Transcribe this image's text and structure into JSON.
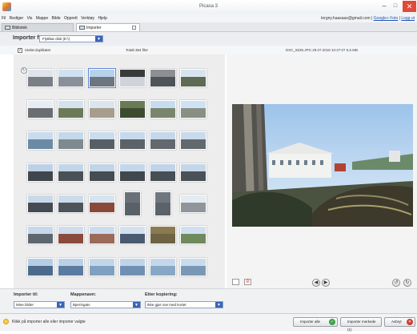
{
  "window": {
    "title": "Picasa 3",
    "min_glyph": "–",
    "max_glyph": "□",
    "close_glyph": "✕"
  },
  "menu": [
    "Fil",
    "Rediger",
    "Vis",
    "Mappe",
    "Bilde",
    "Opprett",
    "Verktøy",
    "Hjelp"
  ],
  "account": {
    "email": "torgny.haasaas@gmail.com",
    "sep": "|",
    "link1": "Google+ Foto",
    "link2": "Logg ut"
  },
  "tabs": [
    {
      "label": "Bibliotek"
    },
    {
      "label": "Importer"
    }
  ],
  "import_from": {
    "label": "Importer fra:",
    "source": "Flyttbar disk (E:\\)"
  },
  "info": {
    "duplicates_label": "Utelat duplikater",
    "duplicates_checked": "✓",
    "total": "Totalt 364 filer",
    "file_info": "DSC_5535.JPG   29.07.2018 10:27:07   5,6 MB"
  },
  "thumbnail_grid": {
    "rotate_glyph": "↻",
    "selected_index": 2,
    "rows": [
      [
        {
          "sky": "#dfe4ea",
          "ground": "#7a7f86"
        },
        {
          "sky": "#cfe0f0",
          "ground": "#8a9098"
        },
        {
          "sky": "#b7d1ea",
          "ground": "#6d7580"
        },
        {
          "sky": "#3a3a3a",
          "ground": "#cfd4da"
        },
        {
          "sky": "#8d8f92",
          "ground": "#4f5458"
        },
        {
          "sky": "#d7e3ef",
          "ground": "#5f6a55"
        }
      ],
      [
        {
          "sky": "#e7ecf2",
          "ground": "#6a6e73"
        },
        {
          "sky": "#d4e2f0",
          "ground": "#6c7a5a"
        },
        {
          "sky": "#dbe5ef",
          "ground": "#a69d8c"
        },
        {
          "sky": "#6a7a55",
          "ground": "#3c4b2f"
        },
        {
          "sky": "#c7dcef",
          "ground": "#79866c"
        },
        {
          "sky": "#cfe2f3",
          "ground": "#8a8f84"
        }
      ],
      [
        {
          "sky": "#c9dbee",
          "ground": "#6b8aa3"
        },
        {
          "sky": "#c5d8ea",
          "ground": "#7d8b8f"
        },
        {
          "sky": "#cadcee",
          "ground": "#585e66"
        },
        {
          "sky": "#c7d9ec",
          "ground": "#5b6268"
        },
        {
          "sky": "#c5d7ea",
          "ground": "#62686e"
        },
        {
          "sky": "#c8daec",
          "ground": "#62696e"
        }
      ],
      [
        {
          "sky": "#bdd1e6",
          "ground": "#3f464c"
        },
        {
          "sky": "#c3d6e9",
          "ground": "#495056"
        },
        {
          "sky": "#c1d4e8",
          "ground": "#454c52"
        },
        {
          "sky": "#c4d7ea",
          "ground": "#40474d"
        },
        {
          "sky": "#c0d3e7",
          "ground": "#474e54"
        },
        {
          "sky": "#c4d6e9",
          "ground": "#4a5157"
        }
      ],
      [
        {
          "sky": "#c8d9ea",
          "ground": "#454b52"
        },
        {
          "sky": "#cbdbeb",
          "ground": "#4d545a"
        },
        {
          "sky": "#d7e4f0",
          "ground": "#8a4a3a"
        },
        {
          "sky": "#6a7078",
          "ground": "#5a6068",
          "tall": true
        },
        {
          "sky": "#707680",
          "ground": "#5c626a",
          "tall": true
        },
        {
          "sky": "#e4ebf2",
          "ground": "#8f959b"
        }
      ],
      [
        {
          "sky": "#c6d8ea",
          "ground": "#5e6670"
        },
        {
          "sky": "#cfdded",
          "ground": "#8b4b3c"
        },
        {
          "sky": "#cbdcee",
          "ground": "#9b6a58"
        },
        {
          "sky": "#d3e1ef",
          "ground": "#4a5a70"
        },
        {
          "sky": "#8a7a52",
          "ground": "#6e6343"
        },
        {
          "sky": "#d0e0f0",
          "ground": "#6f8a5c"
        }
      ],
      [
        {
          "sky": "#b5cde6",
          "ground": "#4c6b8c"
        },
        {
          "sky": "#b9d0e7",
          "ground": "#5b7ba0"
        },
        {
          "sky": "#c2d6ea",
          "ground": "#7fa0c0"
        },
        {
          "sky": "#bfd4e9",
          "ground": "#6f90b2"
        },
        {
          "sky": "#c4d7ea",
          "ground": "#88a7c4"
        },
        {
          "sky": "#c9dbec",
          "ground": "#7a98b6"
        }
      ]
    ]
  },
  "preview": {
    "rotate_left": "↺",
    "rotate_right": "↻",
    "prev": "◀",
    "next": "▶",
    "exclude": "⊘"
  },
  "bottom": {
    "import_to_label": "Importer til:",
    "import_to_value": "Mine bilder",
    "folder_label": "Mappenavn:",
    "folder_value": "Bjerringatv",
    "after_copy_label": "Etter kopiering:",
    "after_copy_value": "Ikke gjør noe med kortet",
    "dd_glyph": "▼"
  },
  "status": {
    "text": "Klikk på importer alle eller importer valgte",
    "import_all": "Importer alle",
    "import_selected": "Importer merkede (1)",
    "cancel": "Avbryt",
    "ok_glyph": "✓",
    "no_glyph": "✕"
  }
}
